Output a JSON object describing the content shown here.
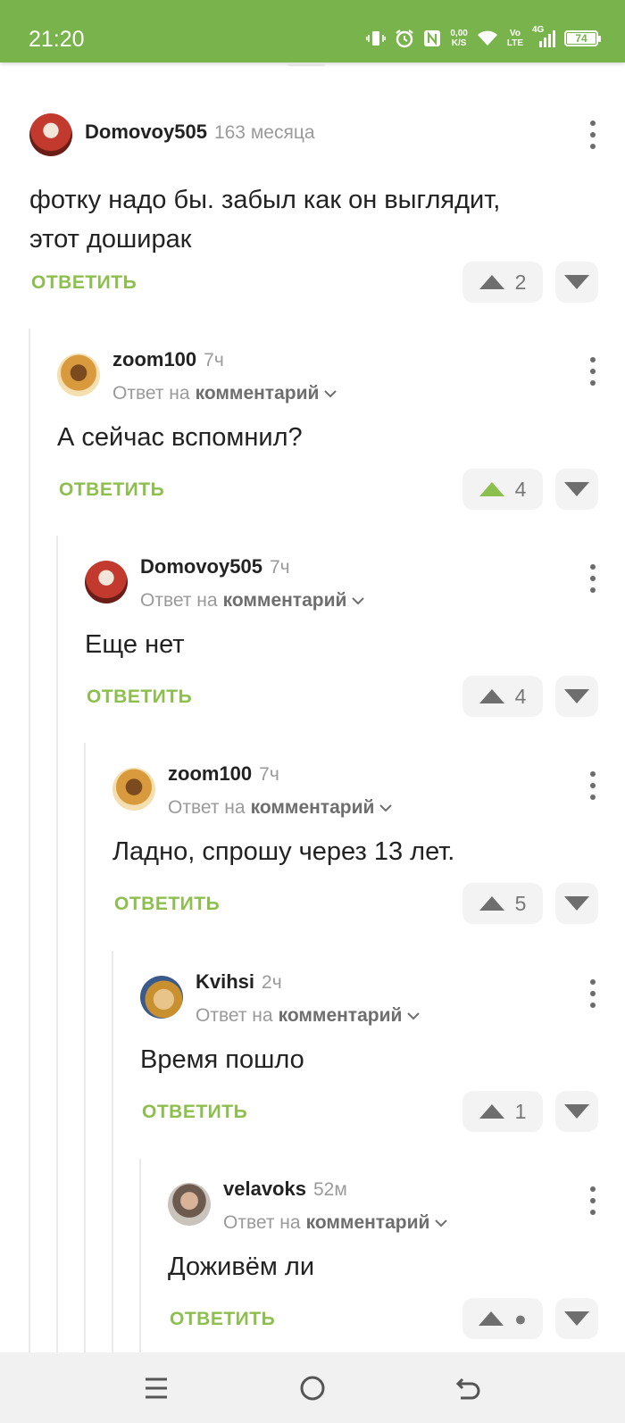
{
  "status_bar": {
    "time": "21:20",
    "speed_value": "0,00",
    "speed_unit": "K/S",
    "volte_top": "Vo",
    "volte_bottom": "LTE",
    "network": "4G",
    "battery": "74",
    "icons": [
      "vibrate-icon",
      "alarm-icon",
      "nfc-icon",
      "wifi-icon",
      "signal-icon",
      "battery-icon"
    ]
  },
  "colors": {
    "accent_green": "#78b34b",
    "reply_green": "#8dbf4f",
    "upvote_active": "#8dbf4f",
    "muted": "#9a9a9a"
  },
  "comments": [
    {
      "author": "Domovoy505",
      "time": "163 месяца",
      "text_line1": "фотку надо бы. забыл как он выглядит,",
      "text_line2": "этот доширак",
      "reply_label": "ОТВЕТИТЬ",
      "votes": "2"
    },
    {
      "author": "zoom100",
      "time": "7ч",
      "reply_prefix": "Ответ на",
      "reply_target": "комментарий",
      "text": "А сейчас вспомнил?",
      "reply_label": "ОТВЕТИТЬ",
      "votes": "4",
      "upvoted": true
    },
    {
      "author": "Domovoy505",
      "time": "7ч",
      "reply_prefix": "Ответ на",
      "reply_target": "комментарий",
      "text": "Еще нет",
      "reply_label": "ОТВЕТИТЬ",
      "votes": "4"
    },
    {
      "author": "zoom100",
      "time": "7ч",
      "reply_prefix": "Ответ на",
      "reply_target": "комментарий",
      "text": "Ладно, спрошу через 13 лет.",
      "reply_label": "ОТВЕТИТЬ",
      "votes": "5"
    },
    {
      "author": "Kvihsi",
      "time": "2ч",
      "reply_prefix": "Ответ на",
      "reply_target": "комментарий",
      "text": "Время пошло",
      "reply_label": "ОТВЕТИТЬ",
      "votes": "1"
    },
    {
      "author": "velavoks",
      "time": "52м",
      "reply_prefix": "Ответ на",
      "reply_target": "комментарий",
      "text": "Доживём ли",
      "reply_label": "ОТВЕТИТЬ",
      "votes": "●"
    }
  ]
}
